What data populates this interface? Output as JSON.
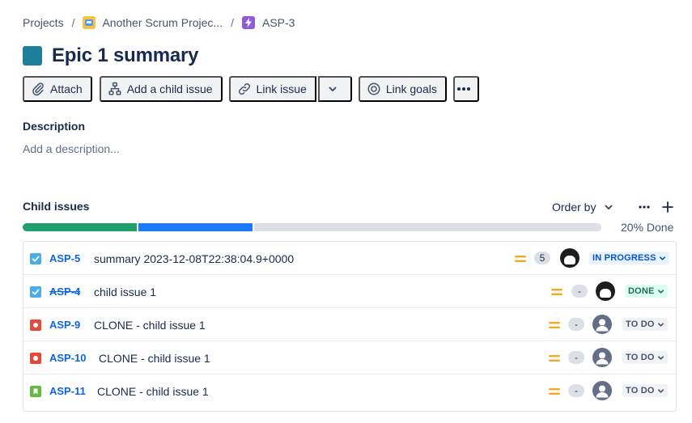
{
  "breadcrumb": {
    "projects": "Projects",
    "project_name": "Another Scrum Projec...",
    "issue_key": "ASP-3",
    "separator": "/"
  },
  "epic": {
    "title": "Epic 1 summary",
    "color": "#1d7f99"
  },
  "toolbar": {
    "attach": "Attach",
    "add_child": "Add a child issue",
    "link_issue": "Link issue",
    "link_goals": "Link goals"
  },
  "description": {
    "label": "Description",
    "placeholder": "Add a description..."
  },
  "child_issues": {
    "label": "Child issues",
    "order_by": "Order by",
    "progress": {
      "done_fraction": 0.2,
      "in_progress_fraction": 0.2,
      "text": "20% Done"
    },
    "items": [
      {
        "key": "ASP-5",
        "type": "subtask",
        "summary": "summary 2023-12-08T22:38:04.9+0000",
        "priority": "medium",
        "estimate": "5",
        "assignee": "photo",
        "status": "IN PROGRESS"
      },
      {
        "key": "ASP-4",
        "type": "subtask",
        "summary": "child issue 1",
        "priority": "medium",
        "estimate": "-",
        "assignee": "photo",
        "status": "DONE"
      },
      {
        "key": "ASP-9",
        "type": "bug",
        "summary": "CLONE - child issue 1",
        "priority": "medium",
        "estimate": "-",
        "assignee": "unassigned",
        "status": "TO DO"
      },
      {
        "key": "ASP-10",
        "type": "bug",
        "summary": "CLONE - child issue 1",
        "priority": "medium",
        "estimate": "-",
        "assignee": "unassigned",
        "status": "TO DO"
      },
      {
        "key": "ASP-11",
        "type": "story",
        "summary": "CLONE - child issue 1",
        "priority": "medium",
        "estimate": "-",
        "assignee": "unassigned",
        "status": "TO DO"
      }
    ]
  },
  "colors": {
    "done": "#22a06b",
    "in_progress": "#1d7afc",
    "link": "#0c66e4",
    "priority_medium": "#f5a623",
    "subtask_icon": "#4bade8",
    "bug_icon": "#e5493a",
    "story_icon": "#63ba3c"
  }
}
